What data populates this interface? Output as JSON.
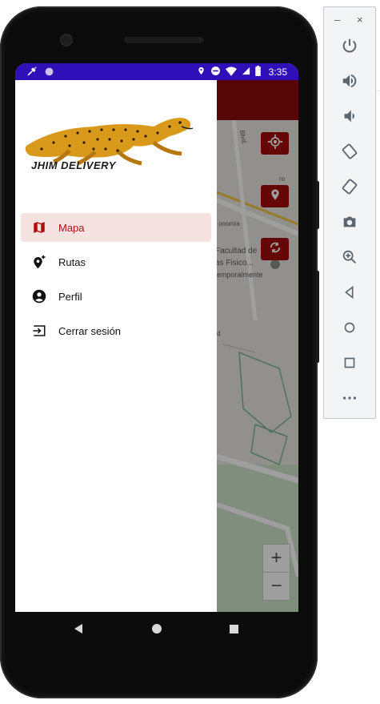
{
  "status_bar": {
    "time": "3:35"
  },
  "app": {
    "brand": "JHIM DELIVERY"
  },
  "drawer": {
    "items": [
      {
        "label": "Mapa",
        "icon": "map-icon",
        "active": true
      },
      {
        "label": "Rutas",
        "icon": "add-location-icon",
        "active": false
      },
      {
        "label": "Perfil",
        "icon": "account-circle-icon",
        "active": false
      },
      {
        "label": "Cerrar sesión",
        "icon": "logout-icon",
        "active": false
      }
    ]
  },
  "map": {
    "labels": [
      "Facultad de",
      "as Fisico...",
      "emporalmente",
      "Blvd.",
      "onomía",
      "ro",
      "d"
    ],
    "zoom_in": "+",
    "zoom_out": "−"
  },
  "colors": {
    "primary": "#8b0b0b",
    "accent": "#b00e0e",
    "status_bar": "#2f0fb8",
    "active_bg": "#f7e2e2"
  },
  "emulator_panel": {
    "window_controls": [
      "–",
      "×"
    ],
    "buttons": [
      "power-icon",
      "volume-up-icon",
      "volume-down-icon",
      "rotate-left-icon",
      "rotate-right-icon",
      "camera-icon",
      "zoom-icon",
      "back-icon",
      "home-icon",
      "overview-icon",
      "more-icon"
    ]
  }
}
